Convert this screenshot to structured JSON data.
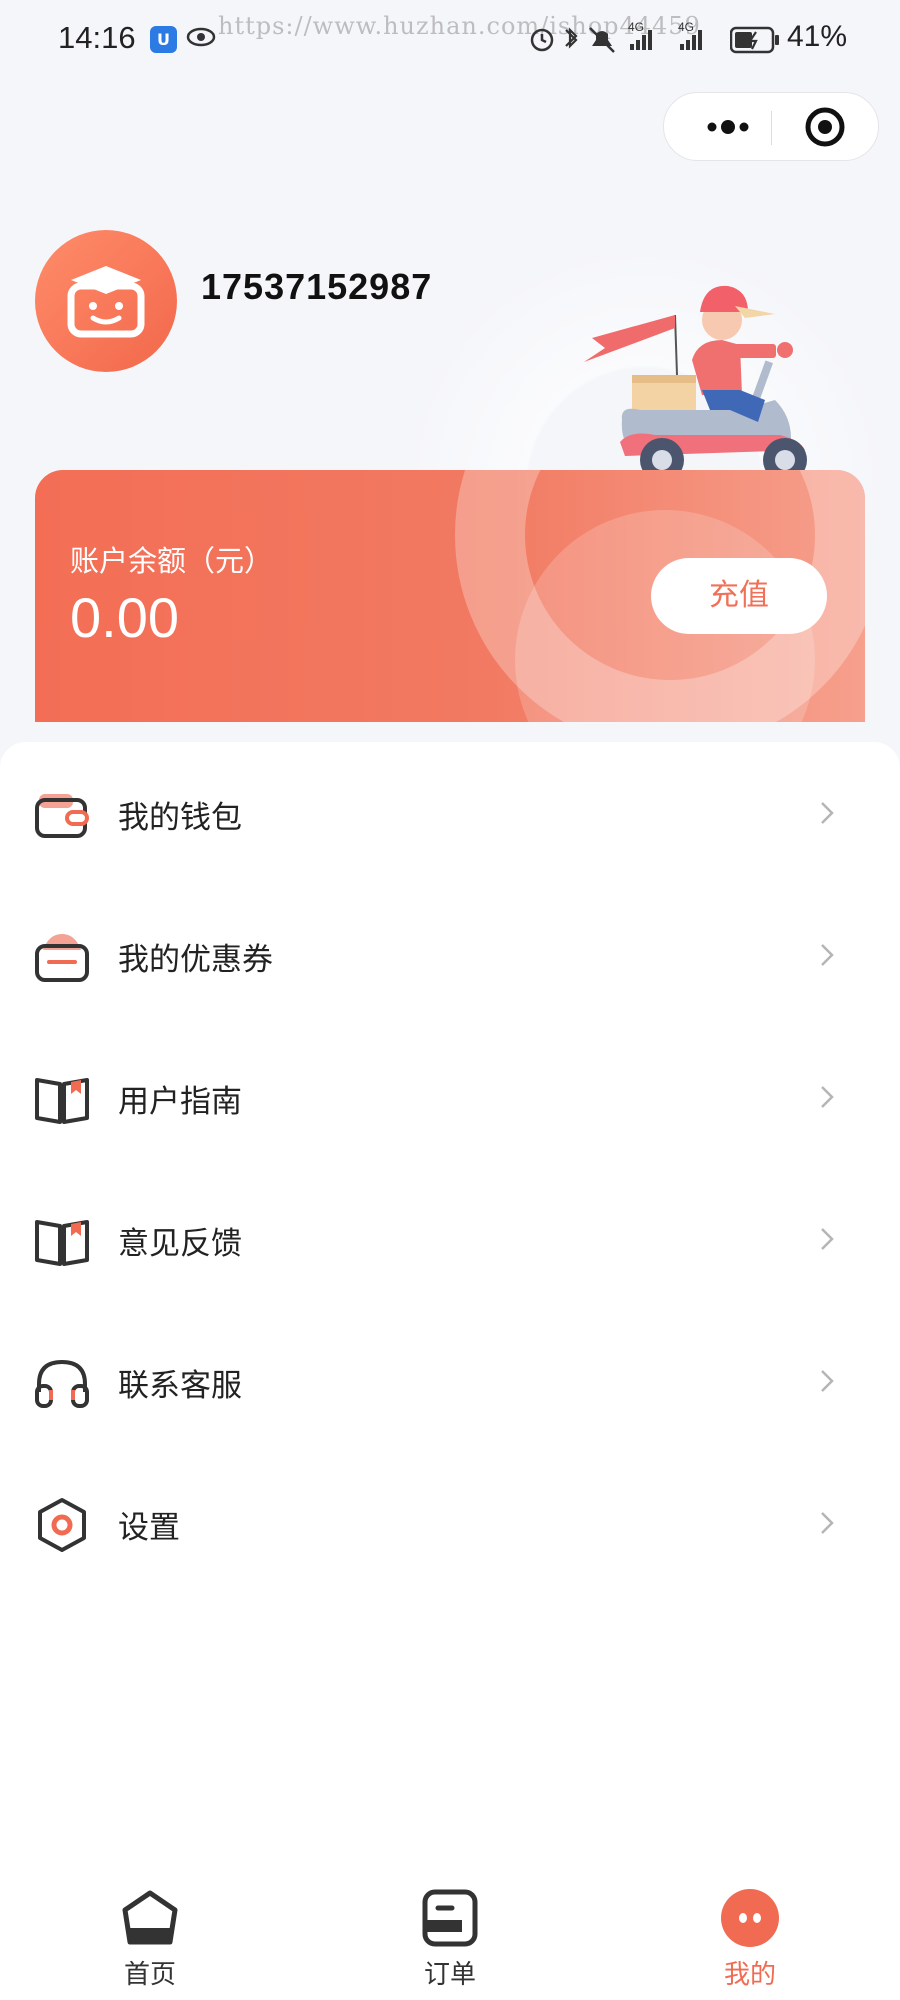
{
  "status_bar": {
    "time": "14:16",
    "app_badge": "U",
    "watermark": "https://www.huzhan.com/ishop44459",
    "network_1": "4G",
    "network_2": "4G",
    "battery_percent": "41%"
  },
  "user": {
    "phone": "17537152987"
  },
  "balance": {
    "label": "账户余额（元）",
    "value": "0.00",
    "recharge_label": "充值"
  },
  "menu": [
    {
      "label": "我的钱包",
      "icon": "wallet-icon"
    },
    {
      "label": "我的优惠券",
      "icon": "coupon-icon"
    },
    {
      "label": "用户指南",
      "icon": "book-icon"
    },
    {
      "label": "意见反馈",
      "icon": "book-icon"
    },
    {
      "label": "联系客服",
      "icon": "headset-icon"
    },
    {
      "label": "设置",
      "icon": "settings-icon"
    }
  ],
  "tabs": [
    {
      "label": "首页",
      "icon": "home-icon",
      "active": false
    },
    {
      "label": "订单",
      "icon": "order-icon",
      "active": false
    },
    {
      "label": "我的",
      "icon": "profile-icon",
      "active": true
    }
  ],
  "colors": {
    "accent": "#f06b52",
    "card_start": "#f36e55",
    "card_end": "#f6a08d",
    "background": "#f5f6fa"
  }
}
